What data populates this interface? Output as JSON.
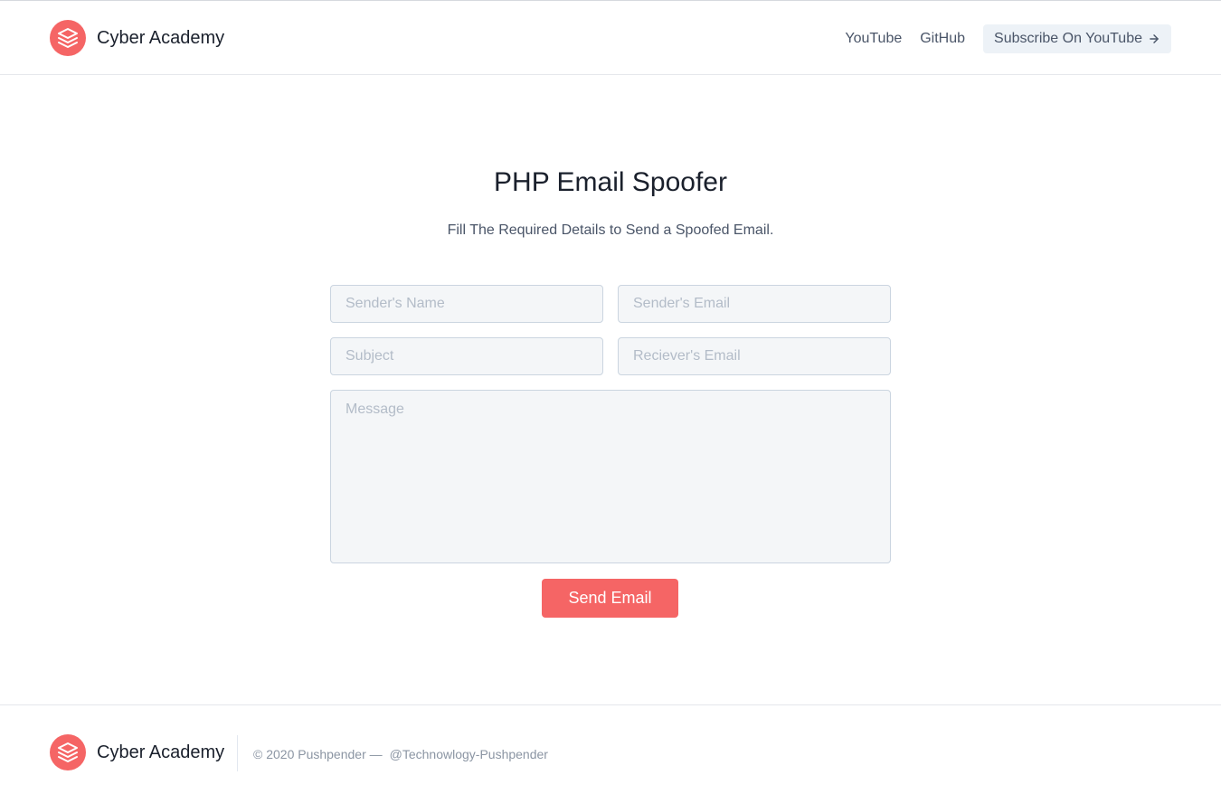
{
  "colors": {
    "accent": "#f56565",
    "subscribe_bg": "#edf2f7",
    "logo_stroke": "#ffffff"
  },
  "header": {
    "brand_name": "Cyber Academy",
    "logo_icon": "layers-icon",
    "nav": {
      "youtube": "YouTube",
      "github": "GitHub",
      "subscribe": "Subscribe On YouTube",
      "subscribe_icon": "arrow-right-icon"
    }
  },
  "main": {
    "title": "PHP Email Spoofer",
    "subtitle": "Fill The Required Details to Send a Spoofed Email.",
    "form": {
      "sender_name_placeholder": "Sender's Name",
      "sender_email_placeholder": "Sender's Email",
      "subject_placeholder": "Subject",
      "receiver_email_placeholder": "Reciever's Email",
      "message_placeholder": "Message",
      "submit_label": "Send Email"
    }
  },
  "footer": {
    "brand_name": "Cyber Academy",
    "copyright": "© 2020 Pushpender —",
    "handle": "@Technowlogy-Pushpender"
  }
}
